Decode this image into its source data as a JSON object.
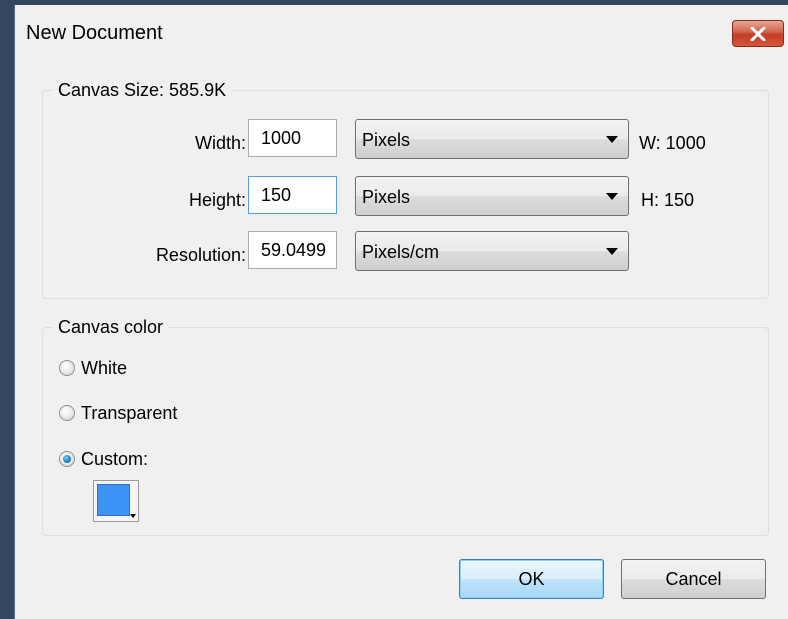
{
  "window": {
    "title": "New Document",
    "close_icon": "close-icon"
  },
  "canvas_size": {
    "legend": "Canvas Size: 585.9K",
    "width": {
      "label": "Width:",
      "value": "1000",
      "unit": "Pixels",
      "readout": "W: 1000"
    },
    "height": {
      "label": "Height:",
      "value": "150",
      "unit": "Pixels",
      "readout": "H: 150"
    },
    "resolution": {
      "label": "Resolution:",
      "value": "59.0499",
      "unit": "Pixels/cm"
    }
  },
  "canvas_color": {
    "legend": "Canvas color",
    "options": [
      {
        "label": "White",
        "checked": false
      },
      {
        "label": "Transparent",
        "checked": false
      },
      {
        "label": "Custom:",
        "checked": true
      }
    ],
    "custom_color": "#3d93f7"
  },
  "buttons": {
    "ok": "OK",
    "cancel": "Cancel"
  }
}
